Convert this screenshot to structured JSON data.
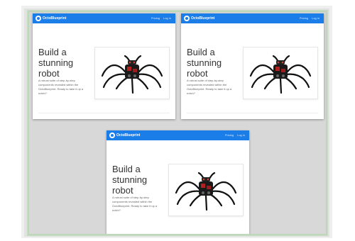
{
  "frames": [
    {
      "nav": {
        "brand": "OctoBlueprint",
        "links": [
          "Pricing",
          "Log in"
        ]
      },
      "hero": {
        "title_lines": [
          "Build a",
          "stunning",
          "robot"
        ],
        "description": "A robust suite of step-by-step components revealed within the OctoBlueprint. Ready to take it up a notch?"
      }
    },
    {
      "nav": {
        "brand": "OctoBlueprint",
        "links": [
          "Pricing",
          "Log in"
        ]
      },
      "hero": {
        "title_lines": [
          "Build a",
          "stunning",
          "robot"
        ],
        "description": "A robust suite of step-by-step components revealed within the OctoBlueprint. Ready to take it up a notch?"
      }
    },
    {
      "nav": {
        "brand": "OctoBlueprint",
        "links": [
          "Pricing",
          "Log in"
        ]
      },
      "hero": {
        "title_lines": [
          "Build a",
          "stunning",
          "robot"
        ],
        "description": "A robust suite of step-by-step components revealed within the OctoBlueprint. Ready to take it up a notch?"
      }
    }
  ],
  "icons": {
    "brand": "octo-logo-icon",
    "hero_image": "hexapod-robot-image"
  },
  "colors": {
    "navbar": "#1a7de8",
    "title": "#333333",
    "body_text": "#666666",
    "canvas": "#d8d8d8"
  }
}
